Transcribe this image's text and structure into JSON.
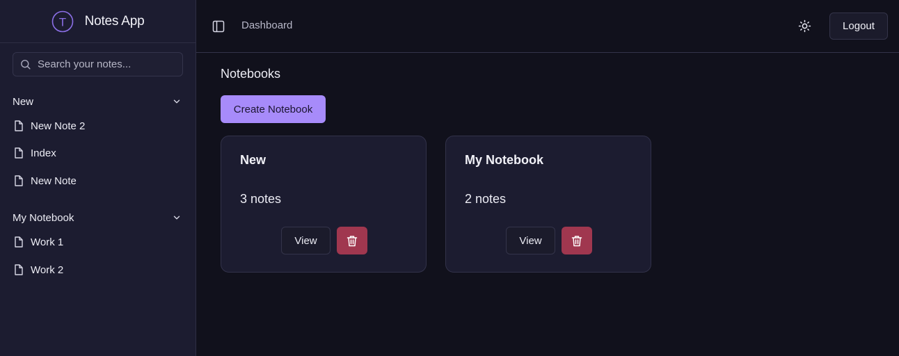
{
  "brand": {
    "name": "Notes App",
    "logo_letter": "T"
  },
  "search": {
    "placeholder": "Search your notes..."
  },
  "sidebar": {
    "groups": [
      {
        "label": "New",
        "notes": [
          "New Note 2",
          "Index",
          "New Note"
        ]
      },
      {
        "label": "My Notebook",
        "notes": [
          "Work 1",
          "Work 2"
        ]
      }
    ]
  },
  "header": {
    "breadcrumb": "Dashboard",
    "logout_label": "Logout"
  },
  "main": {
    "section_title": "Notebooks",
    "create_label": "Create Notebook",
    "notebooks": [
      {
        "title": "New",
        "count": "3 notes",
        "view_label": "View"
      },
      {
        "title": "My Notebook",
        "count": "2 notes",
        "view_label": "View"
      }
    ]
  },
  "colors": {
    "accent": "#a78bfa",
    "danger": "#a0374f",
    "sidebar_bg": "#1c1c30",
    "main_bg": "#11111c"
  },
  "icons": {
    "logo": "circle-t-logo",
    "search": "search-icon",
    "chevron": "chevron-down-icon",
    "note": "file-icon",
    "sidebar_toggle": "panel-left-icon",
    "theme": "sun-icon",
    "delete": "trash-icon"
  }
}
